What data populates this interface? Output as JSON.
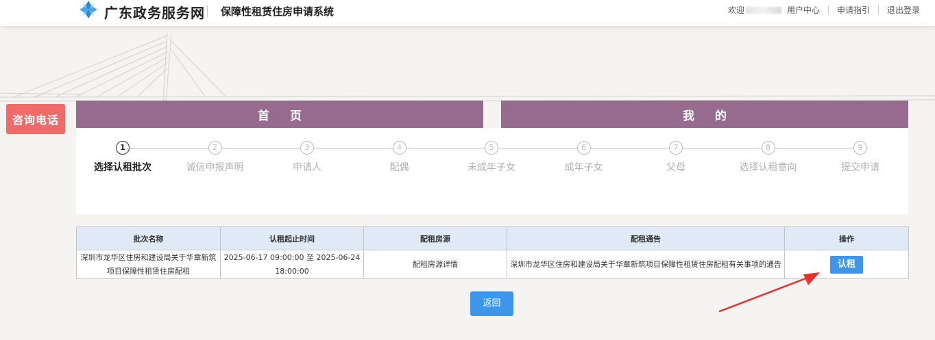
{
  "header": {
    "brand": "广东政务服务网",
    "system_name": "保障性租赁住房申请系统",
    "welcome": "欢迎",
    "nav": [
      "用户中心",
      "申请指引",
      "退出登录"
    ]
  },
  "consult_label": "咨询电话",
  "tabs": [
    "首页",
    "我的"
  ],
  "steps": [
    {
      "num": "1",
      "label": "选择认租批次",
      "active": true
    },
    {
      "num": "2",
      "label": "诚信申报声明",
      "active": false
    },
    {
      "num": "3",
      "label": "申请人",
      "active": false
    },
    {
      "num": "4",
      "label": "配偶",
      "active": false
    },
    {
      "num": "5",
      "label": "未成年子女",
      "active": false
    },
    {
      "num": "6",
      "label": "成年子女",
      "active": false
    },
    {
      "num": "7",
      "label": "父母",
      "active": false
    },
    {
      "num": "8",
      "label": "选择认租意向",
      "active": false
    },
    {
      "num": "9",
      "label": "提交申请",
      "active": false
    }
  ],
  "table": {
    "headers": [
      "批次名称",
      "认租起止时间",
      "配租房源",
      "配租通告",
      "操作"
    ],
    "rows": [
      {
        "name": "深圳市龙华区住房和建设局关于华章新筑项目保障性租赁住房配租",
        "period": "2025-06-17 09:00:00 至 2025-06-24 18:00:00",
        "housing": "配租房源详情",
        "notice": "深圳市龙华区住房和建设局关于华章新筑项目保障性租赁住房配租有关事项的通告",
        "action": "认租"
      }
    ]
  },
  "back_label": "返回",
  "colors": {
    "tab_purple": "#976b8e",
    "consult_red": "#f06a6a",
    "button_blue": "#3d96ea",
    "table_header": "#dfeaf6",
    "notice_link": "#1a3cc8",
    "arrow_red": "#e8312a"
  }
}
